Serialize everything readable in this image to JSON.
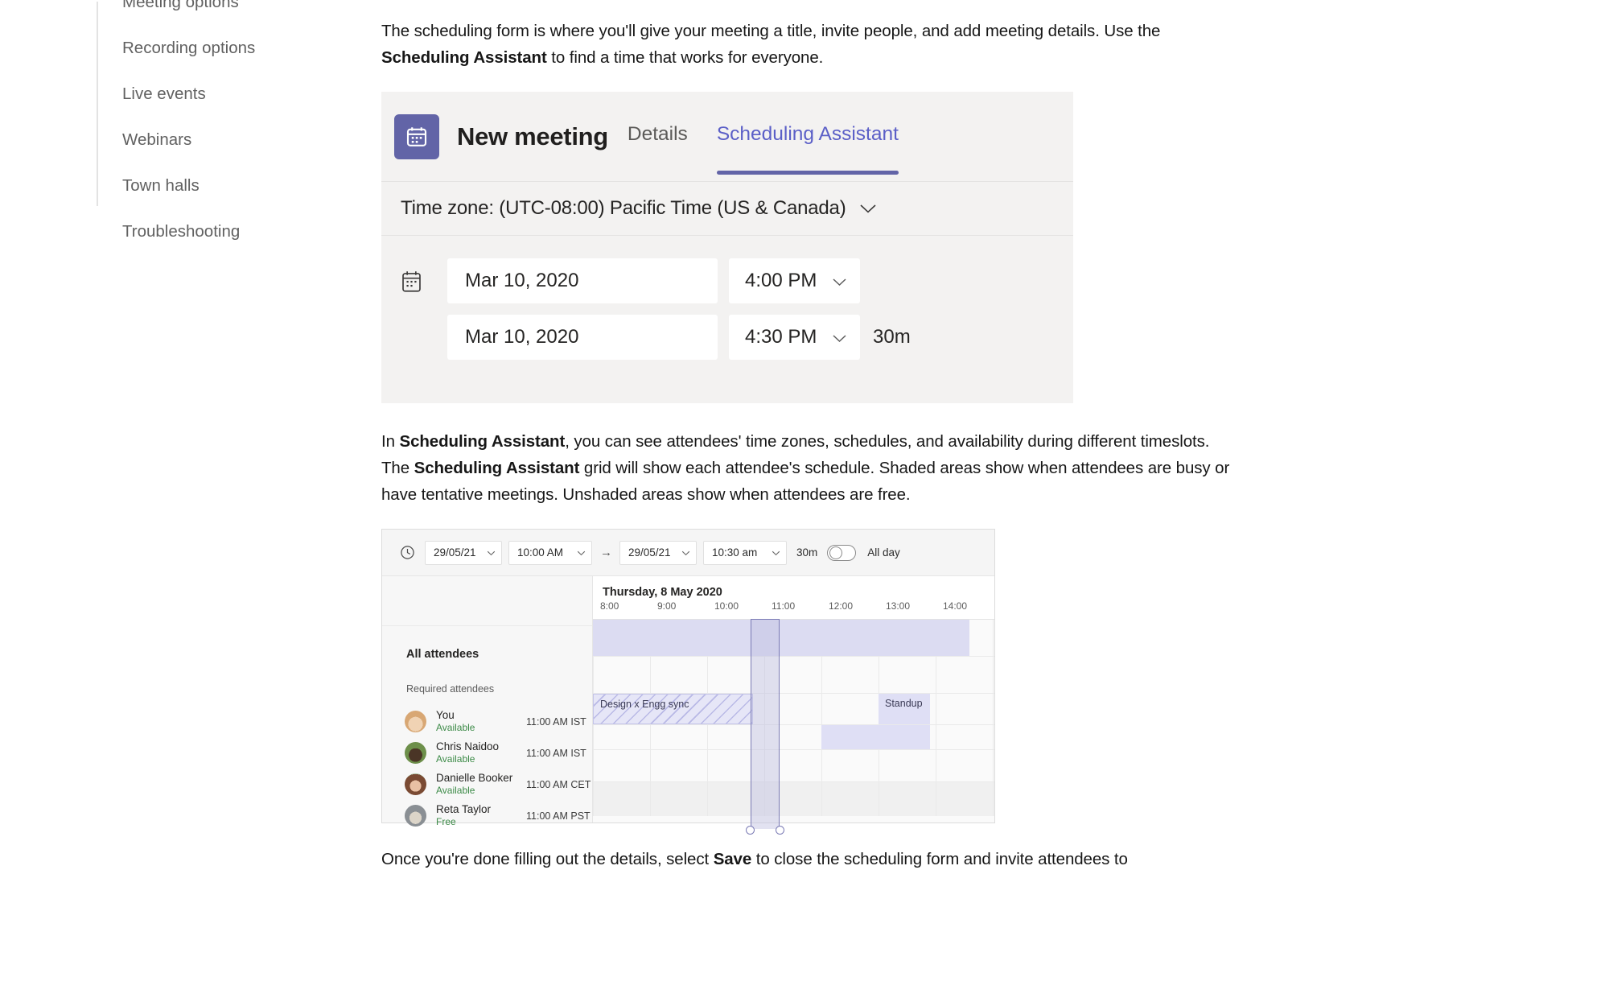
{
  "sidebar": {
    "items": [
      {
        "label": "Meeting options"
      },
      {
        "label": "Recording options"
      },
      {
        "label": "Live events"
      },
      {
        "label": "Webinars"
      },
      {
        "label": "Town halls"
      },
      {
        "label": "Troubleshooting"
      }
    ]
  },
  "article": {
    "para1_part1": "The scheduling form is where you'll give your meeting a title, invite people, and add meeting details. Use the ",
    "para1_bold": "Scheduling Assistant",
    "para1_part2": " to find a time that works for everyone.",
    "para2_part1": "In ",
    "para2_bold1": "Scheduling Assistant",
    "para2_part2": ", you can see attendees' time zones, schedules, and availability during different timeslots. The ",
    "para2_bold2": "Scheduling Assistant",
    "para2_part3": " grid will show each attendee's schedule. Shaded areas show when attendees are busy or have tentative meetings. Unshaded areas show when attendees are free.",
    "para3_part1": "Once you're done filling out the details, select ",
    "para3_bold": "Save",
    "para3_part2": " to close the scheduling form and invite attendees to"
  },
  "new_meeting": {
    "icon": "calendar-icon",
    "title": "New meeting",
    "tab_details": "Details",
    "tab_scheduling_assistant": "Scheduling Assistant",
    "active_tab": "Scheduling Assistant",
    "timezone_label": "Time zone: (UTC-08:00) Pacific Time (US & Canada)",
    "start_date": "Mar 10, 2020",
    "start_time": "4:00 PM",
    "end_date": "Mar 10, 2020",
    "end_time": "4:30 PM",
    "duration": "30m",
    "accent_color": "#6264a7",
    "card_bg": "#f3f2f1"
  },
  "scheduling_assistant": {
    "toolbar": {
      "clock_icon": "clock-icon",
      "start_date": "29/05/21",
      "start_time": "10:00 AM",
      "arrow": "→",
      "end_date": "29/05/21",
      "end_time": "10:30 am",
      "duration": "30m",
      "all_day_label": "All day",
      "all_day_on": false
    },
    "left_panel": {
      "all_attendees_label": "All attendees",
      "required_attendees_label": "Required attendees"
    },
    "attendees": [
      {
        "name": "You",
        "status": "Available",
        "timezone": "11:00 AM IST",
        "avatar_colors": [
          "#e8c9a8",
          "#c89b6b"
        ]
      },
      {
        "name": "Chris Naidoo",
        "status": "Available",
        "timezone": "11:00 AM IST",
        "avatar_colors": [
          "#6d8f4a",
          "#3a2a1d"
        ]
      },
      {
        "name": "Danielle Booker",
        "status": "Available",
        "timezone": "11:00 AM CET",
        "avatar_colors": [
          "#a9c0a0",
          "#7a4a33"
        ]
      },
      {
        "name": "Reta Taylor",
        "status": "Free",
        "timezone": "11:00 AM PST",
        "avatar_colors": [
          "#b9c3cb",
          "#8a8f94"
        ]
      }
    ],
    "grid": {
      "day_label": "Thursday, 8 May 2020",
      "hours": [
        "8:00",
        "9:00",
        "10:00",
        "11:00",
        "12:00",
        "13:00",
        "14:00"
      ],
      "events": [
        {
          "label": "Design x Engg sync",
          "row": "you",
          "start_hour": 8.0,
          "end_hour": 10.8,
          "style": "hatched"
        },
        {
          "label": "Standup",
          "row": "you",
          "start_hour": 13.0,
          "end_hour": 13.9,
          "style": "solid"
        },
        {
          "label": "",
          "row": "chris",
          "start_hour": 11.9,
          "end_hour": 13.9,
          "style": "solid"
        }
      ],
      "all_attendees_band": {
        "start_hour": 8.0,
        "end_hour": 14.6
      },
      "selection": {
        "start_hour": 10.75,
        "end_hour": 11.2
      },
      "busy_color": "#dfdff5",
      "band_color": "#dcdcf2",
      "selection_border": "#7b7bb5"
    }
  }
}
